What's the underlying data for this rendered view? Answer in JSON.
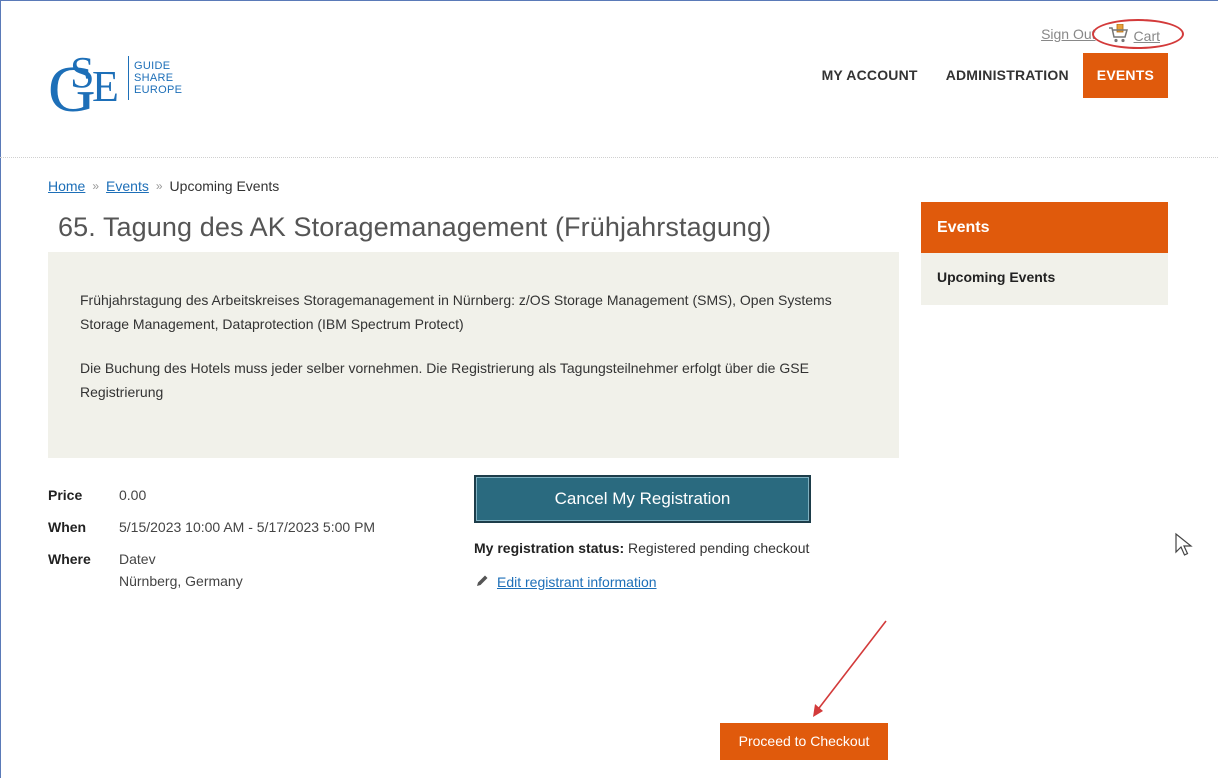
{
  "header": {
    "sign_out": "Sign Out",
    "cart": "Cart",
    "logo_words": [
      "GUIDE",
      "SHARE",
      "EUROPE"
    ],
    "logo_letters": "GSE",
    "nav": [
      {
        "label": "MY ACCOUNT",
        "active": false
      },
      {
        "label": "ADMINISTRATION",
        "active": false
      },
      {
        "label": "EVENTS",
        "active": true
      }
    ]
  },
  "breadcrumb": {
    "home": "Home",
    "sep1": "»",
    "events": "Events",
    "sep2": "»",
    "current": "Upcoming Events"
  },
  "event": {
    "title": "65. Tagung des AK Storagemanagement (Frühjahrstagung)",
    "description": [
      "Frühjahrstagung des Arbeitskreises Storagemanagement in Nürnberg: z/OS Storage Management (SMS), Open Systems Storage Management, Dataprotection (IBM Spectrum Protect)",
      "Die Buchung des Hotels muss jeder selber vornehmen. Die Registrierung als Tagungsteilnehmer erfolgt über die GSE Registrierung"
    ],
    "price_label": "Price",
    "price": "0.00",
    "when_label": "When",
    "when": "5/15/2023 10:00 AM - 5/17/2023 5:00 PM",
    "where_label": "Where",
    "where_line1": "Datev",
    "where_line2": "Nürnberg, Germany"
  },
  "registration": {
    "cancel_button": "Cancel My Registration",
    "status_label": "My registration status:",
    "status_value": "Registered pending checkout",
    "edit_link": "Edit registrant information"
  },
  "sidebar": {
    "title": "Events",
    "items": [
      "Upcoming Events"
    ]
  },
  "checkout_button": "Proceed to Checkout",
  "colors": {
    "accent": "#e05a0c",
    "link": "#1d6fb8",
    "panel": "#f1f1ea",
    "cancel_button": "#2a6a7f",
    "annotation": "#d33a3a"
  }
}
